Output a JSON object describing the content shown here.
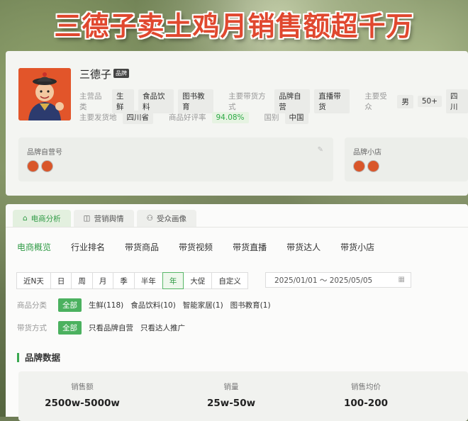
{
  "headline": "三德子卖土鸡月销售额超千万",
  "brand": {
    "name": "三德子",
    "badge": "品牌",
    "row1": {
      "category_label": "主营品类",
      "categories": [
        "生鲜",
        "食品饮料",
        "图书教育"
      ],
      "sales_mode_label": "主要带货方式",
      "sales_modes": [
        "品牌自营",
        "直播带货"
      ],
      "audience_label": "主要受众",
      "audience": [
        "男",
        "50+",
        "四川"
      ]
    },
    "row2": {
      "origin_label": "主要发货地",
      "origin": "四川省",
      "rating_label": "商品好评率",
      "rating": "94.08%",
      "country_label": "国别",
      "country": "中国"
    }
  },
  "subboxes": {
    "self_account": "品牌自营号",
    "shop": "品牌小店"
  },
  "tabs": [
    "电商分析",
    "营销舆情",
    "受众画像"
  ],
  "subnav": [
    "电商概览",
    "行业排名",
    "带货商品",
    "带货视频",
    "带货直播",
    "带货达人",
    "带货小店"
  ],
  "timebar": [
    "近N天",
    "日",
    "周",
    "月",
    "季",
    "半年",
    "年",
    "大促",
    "自定义"
  ],
  "date_range": "2025/01/01 ～ 2025/05/05",
  "filters": {
    "category_label": "商品分类",
    "category_all": "全部",
    "category_items": [
      "生鲜(118)",
      "食品饮料(10)",
      "智能家居(1)",
      "图书教育(1)"
    ],
    "mode_label": "带货方式",
    "mode_all": "全部",
    "mode_items": [
      "只看品牌自营",
      "只看达人推广"
    ]
  },
  "section_title": "品牌数据",
  "stats": [
    {
      "label": "销售额",
      "value": "2500w-5000w"
    },
    {
      "label": "销量",
      "value": "25w-50w"
    },
    {
      "label": "销售均价",
      "value": "100-200"
    }
  ],
  "colors": {
    "accent": "#2e9a44",
    "headline": "#e0482f"
  }
}
